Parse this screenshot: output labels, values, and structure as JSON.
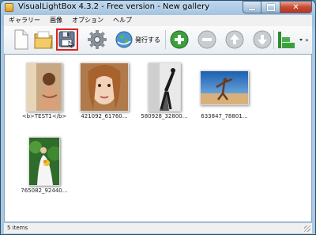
{
  "window": {
    "title": "VisualLightBox 4.3.2 - Free version - New gallery"
  },
  "menu": {
    "items": [
      "ギャラリー",
      "画像",
      "オプション",
      "ヘルプ"
    ]
  },
  "toolbar": {
    "publish_label": "発行する"
  },
  "gallery": {
    "items": [
      {
        "label": "<b>TEST1</b>"
      },
      {
        "label": "421092_61760…"
      },
      {
        "label": "580928_32800…"
      },
      {
        "label": "633847_78801…"
      },
      {
        "label": "765082_92440…"
      }
    ]
  },
  "status": {
    "text": "5 items"
  },
  "colors": {
    "highlight": "#e02020",
    "accent_green": "#3aa13a"
  }
}
